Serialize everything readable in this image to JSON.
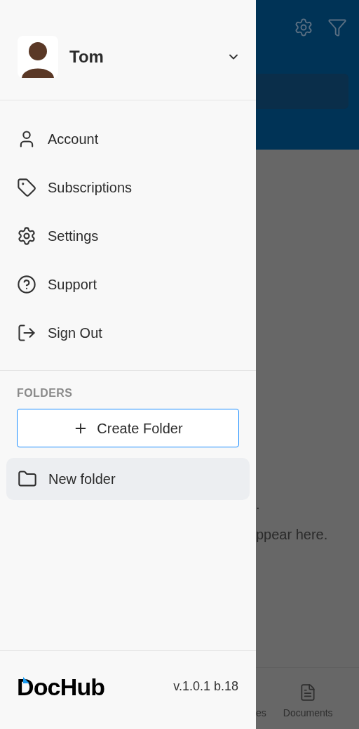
{
  "user": {
    "name": "Tom",
    "expanded": false
  },
  "menu": [
    {
      "label": "Account",
      "kind": "account"
    },
    {
      "label": "Subscriptions",
      "kind": "subscriptions"
    },
    {
      "label": "Settings",
      "kind": "settings"
    },
    {
      "label": "Support",
      "kind": "support"
    },
    {
      "label": "Sign Out",
      "kind": "signout"
    }
  ],
  "folders": {
    "heading": "FOLDERS",
    "create_button": "Create Folder",
    "items": [
      {
        "label": "New folder",
        "selected": true
      }
    ]
  },
  "footer": {
    "logo": "DocHub",
    "version": "v.1.0.1 b.18"
  },
  "background": {
    "empty_text_1": ".",
    "empty_text_2": "ppear here.",
    "tabs": [
      {
        "label": "es",
        "kind": "plain"
      },
      {
        "label": "Documents",
        "kind": "documents"
      }
    ]
  }
}
